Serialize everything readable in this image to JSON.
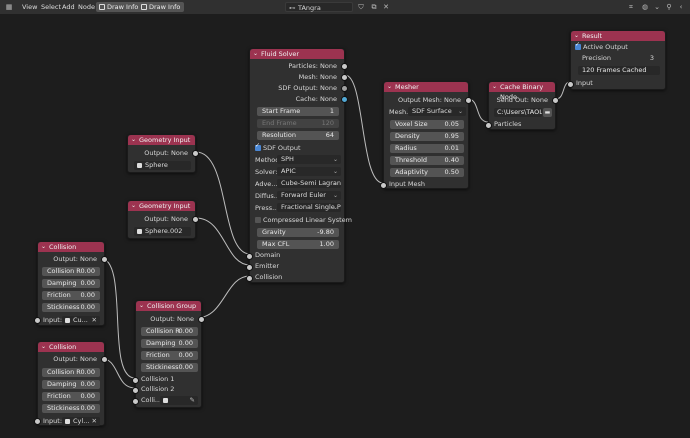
{
  "topbar": {
    "view": "View",
    "select": "Select",
    "add": "Add",
    "node": "Node",
    "draw_info_1": "Draw Info",
    "draw_info_2": "Draw Info",
    "tree_name": "TAngra"
  },
  "fluid_solver": {
    "title": "Fluid Solver",
    "outputs": [
      "Particles: None",
      "Mesh: None",
      "SDF Output: None",
      "Cache: None"
    ],
    "start_frame": {
      "label": "Start Frame",
      "value": "1"
    },
    "end_frame": {
      "label": "End Frame",
      "value": "120"
    },
    "resolution": {
      "label": "Resolution",
      "value": "64"
    },
    "sdf_output": "SDF Output",
    "method": {
      "label": "Method:",
      "value": "SPH"
    },
    "solver": {
      "label": "Solver:",
      "value": "APIC"
    },
    "advection": {
      "label": "Adve...",
      "value": "Cube-Semi Lagran..."
    },
    "diffusion": {
      "label": "Diffus...",
      "value": "Forward Euler"
    },
    "pressure": {
      "label": "Press...",
      "value": "Fractional Single Ph..."
    },
    "compressed": "Compressed Linear System",
    "gravity": {
      "label": "Gravity",
      "value": "-9.80"
    },
    "max_cfl": {
      "label": "Max CFL",
      "value": "1.00"
    },
    "inputs": [
      "Domain",
      "Emitter",
      "Collision"
    ]
  },
  "mesher": {
    "title": "Mesher",
    "output": "Output Mesh: None",
    "mesh_label": "Mesh...",
    "mesh_value": "SDF Surface",
    "fields": [
      {
        "label": "Voxel Size",
        "value": "0.05"
      },
      {
        "label": "Density",
        "value": "0.95"
      },
      {
        "label": "Radius",
        "value": "0.01"
      },
      {
        "label": "Threshold",
        "value": "0.40"
      },
      {
        "label": "Adaptivity",
        "value": "0.50"
      }
    ],
    "input": "Input Mesh"
  },
  "cache": {
    "title": "Cache Binary Node",
    "output": "Send Out: None",
    "path": "C:\\Users\\TAOL...",
    "input": "Particles"
  },
  "result": {
    "title": "Result",
    "active_output": "Active Output",
    "precision": {
      "label": "Precision",
      "value": "3"
    },
    "status": "120 Frames Cached",
    "input": "Input"
  },
  "geometry_input_1": {
    "title": "Geometry Input",
    "output": "Output: None",
    "object": "Sphere"
  },
  "geometry_input_2": {
    "title": "Geometry Input",
    "output": "Output: None",
    "object": "Sphere.002"
  },
  "collision_1": {
    "title": "Collision",
    "output": "Output: None",
    "fields": [
      {
        "label": "Collision R",
        "value": "0.00"
      },
      {
        "label": "Damping",
        "value": "0.00"
      },
      {
        "label": "Friction",
        "value": "0.00"
      },
      {
        "label": "Stickiness",
        "value": "0.00"
      }
    ],
    "input_label": "Input:",
    "input_value": "Cu..."
  },
  "collision_2": {
    "title": "Collision",
    "output": "Output: None",
    "fields": [
      {
        "label": "Collision R",
        "value": "0.00"
      },
      {
        "label": "Damping",
        "value": "0.00"
      },
      {
        "label": "Friction",
        "value": "0.00"
      },
      {
        "label": "Stickiness",
        "value": "0.00"
      }
    ],
    "input_label": "Input:",
    "input_value": "Cyl..."
  },
  "collision_group": {
    "title": "Collision Group",
    "output": "Output: None",
    "fields": [
      {
        "label": "Collision R",
        "value": "0.00"
      },
      {
        "label": "Damping",
        "value": "0.00"
      },
      {
        "label": "Friction",
        "value": "0.00"
      },
      {
        "label": "Stickiness",
        "value": "0.00"
      }
    ],
    "inputs": [
      "Collision 1",
      "Collision 2"
    ],
    "input3_label": "Colli..."
  }
}
